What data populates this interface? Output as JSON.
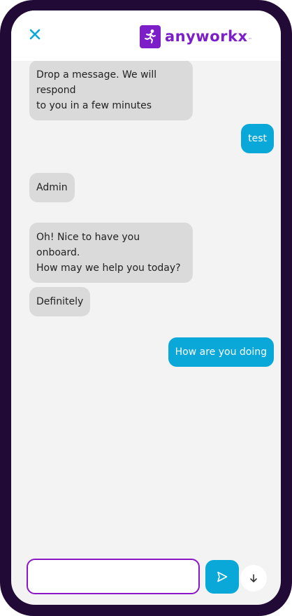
{
  "header": {
    "close_icon": "close-icon",
    "logo_icon": "runner-icon",
    "brand_name": "anyworkx",
    "brand_mark": "™",
    "brand_color": "#7c1fc9",
    "close_color": "#0aa8d8"
  },
  "messages": [
    {
      "sender": "agent",
      "text": "Drop a message. We will respond\nto you in a few minutes"
    },
    {
      "sender": "user",
      "text": "test"
    },
    {
      "sender": "agent",
      "text": "Admin"
    },
    {
      "sender": "agent",
      "text": "Oh! Nice to have you onboard.\nHow may we help you today?"
    },
    {
      "sender": "agent",
      "text": "Definitely"
    },
    {
      "sender": "user",
      "text": "How are you doing"
    }
  ],
  "composer": {
    "input_value": "",
    "input_placeholder": "",
    "send_icon": "send-icon",
    "scroll_icon": "arrow-down-icon",
    "accent_color": "#0aa8d8",
    "input_border_color": "#8a16c4"
  },
  "colors": {
    "frame": "#220a36",
    "chat_background": "#f3f3f4",
    "agent_bubble": "#dadada",
    "user_bubble": "#0aa8d8"
  }
}
